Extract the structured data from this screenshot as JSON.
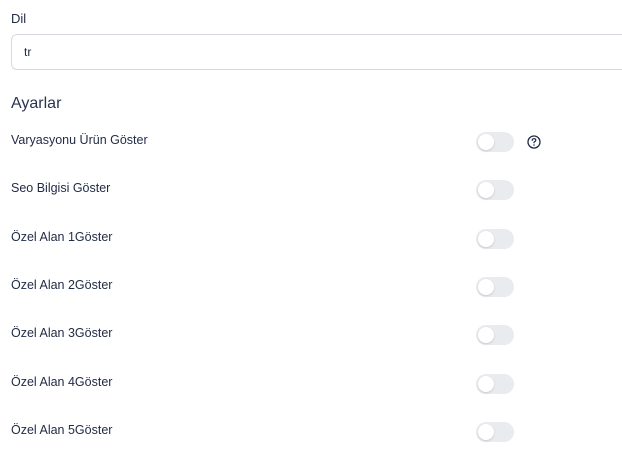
{
  "language": {
    "label": "Dil",
    "value": "tr"
  },
  "settings": {
    "title": "Ayarlar",
    "items": [
      {
        "label": "Varyasyonu Ürün Göster",
        "enabled": false,
        "help_icon": "question-circle-icon"
      },
      {
        "label": "Seo Bilgisi Göster",
        "enabled": false
      },
      {
        "label": "Özel Alan 1Göster",
        "enabled": false
      },
      {
        "label": "Özel Alan 2Göster",
        "enabled": false
      },
      {
        "label": "Özel Alan 3Göster",
        "enabled": false
      },
      {
        "label": "Özel Alan 4Göster",
        "enabled": false
      },
      {
        "label": "Özel Alan 5Göster",
        "enabled": false
      }
    ]
  },
  "colors": {
    "toggle_off": "#e9ebef",
    "text": "#1f2a44",
    "border": "#d6d9de"
  }
}
